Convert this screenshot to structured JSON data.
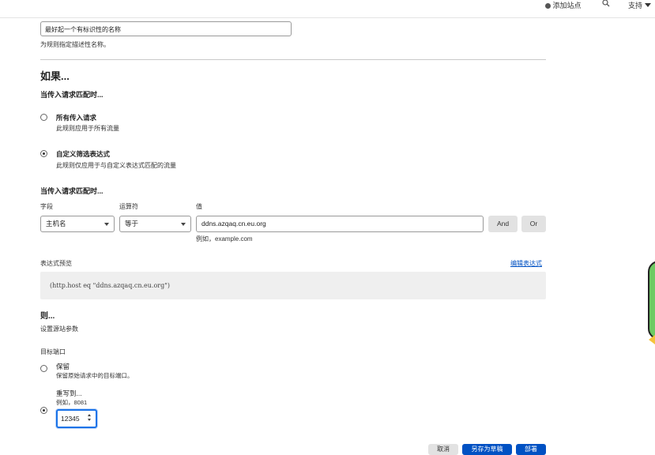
{
  "topbar": {
    "add_site": "添加站点",
    "support": "支持"
  },
  "rule_name": {
    "value": "最好起一个有标识性的名称",
    "help": "为规则指定描述性名称。"
  },
  "if_section": {
    "heading": "如果...",
    "when_label": "当传入请求匹配时...",
    "options": [
      {
        "title": "所有传入请求",
        "desc": "此规则应用于所有流量",
        "selected": false
      },
      {
        "title": "自定义筛选表达式",
        "desc": "此规则仅应用于与自定义表达式匹配的流量",
        "selected": true
      }
    ],
    "when_label_2": "当传入请求匹配时...",
    "field_label": "字段",
    "operator_label": "运算符",
    "value_label": "值",
    "field_value": "主机名",
    "operator_value": "等于",
    "value_value": "ddns.azqaq.cn.eu.org",
    "value_example": "例如，example.com",
    "and_label": "And",
    "or_label": "Or"
  },
  "preview": {
    "label": "表达式预览",
    "edit_link": "编辑表达式",
    "code": "(http.host eq \"ddns.azqaq.cn.eu.org\")"
  },
  "then_section": {
    "heading": "则...",
    "set_label": "设置源站参数",
    "port_label": "目标端口",
    "preserve_title": "保留",
    "preserve_desc": "保留原始请求中的目标端口。",
    "rewrite_title": "重写到...",
    "rewrite_example": "例如，8081",
    "port_value": "12345"
  },
  "footer": {
    "cancel": "取消",
    "save_draft": "另存为草稿",
    "deploy": "部署"
  },
  "colors": {
    "primary": "#0051c3",
    "focus": "#1a73e8"
  }
}
